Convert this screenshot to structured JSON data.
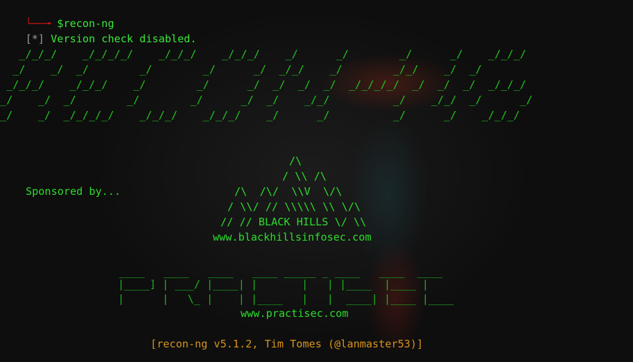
{
  "prompt": {
    "corner": "└──╼ ",
    "command": "$recon-ng"
  },
  "status": {
    "prefix": "[*]",
    "message": " Version check disabled."
  },
  "banner_lines": [
    "   _/_/_/    _/_/_/_/    _/_/_/    _/_/_/    _/      _/        _/      _/    _/_/_/",
    "  _/    _/  _/        _/        _/      _/  _/_/    _/        _/_/    _/  _/",
    " _/_/_/    _/_/_/    _/        _/      _/  _/  _/  _/  _/_/_/_/  _/  _/  _/  _/_/_/",
    "_/    _/  _/        _/        _/      _/  _/    _/_/          _/    _/_/  _/      _/",
    "_/    _/  _/_/_/_/    _/_/_/    _/_/_/    _/      _/          _/      _/    _/_/_/"
  ],
  "sponsor": {
    "label": "Sponsored by...",
    "art": [
      "/\\",
      "/ \\\\ /\\",
      "/\\  /\\/  \\\\V  \\/\\",
      "/ \\\\/ // \\\\\\\\\\ \\\\ \\/\\",
      "// // BLACK HILLS \\/ \\\\"
    ],
    "url": "www.blackhillsinfosec.com"
  },
  "practisec": {
    "art": [
      "____   ____   ____   ____ _____ _ ____   ____  ____",
      "|____] | ___/ |____| |       |   | |____  |____ |",
      "|      |   \\_ |    | |____   |   |  ____| |____ |____"
    ],
    "url": "www.practisec.com"
  },
  "version_line": "[recon-ng v5.1.2, Tim Tomes (@lanmaster53)]"
}
